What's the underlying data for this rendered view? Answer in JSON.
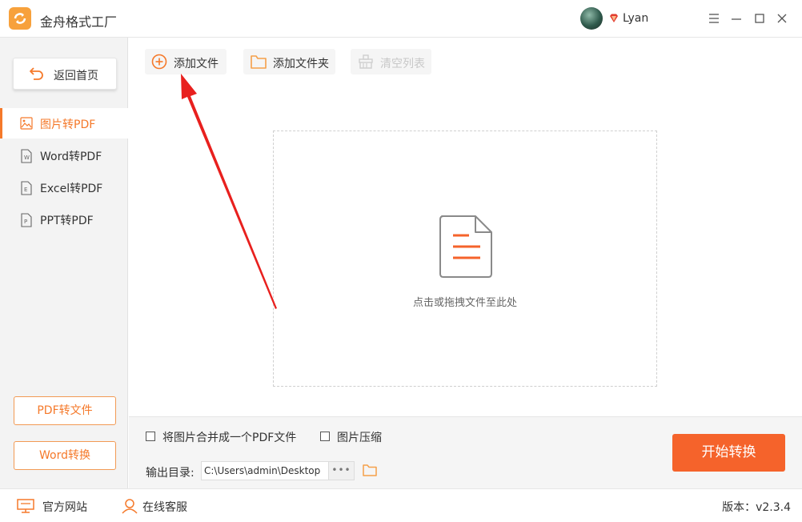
{
  "app": {
    "title": "金舟格式工厂"
  },
  "user": {
    "name": "Lyan"
  },
  "sidebar": {
    "back_label": "返回首页",
    "items": [
      {
        "label": "图片转PDF",
        "active": true
      },
      {
        "label": "Word转PDF",
        "active": false
      },
      {
        "label": "Excel转PDF",
        "active": false
      },
      {
        "label": "PPT转PDF",
        "active": false
      }
    ],
    "bottom_buttons": [
      "PDF转文件",
      "Word转换"
    ]
  },
  "toolbar": {
    "add_file": "添加文件",
    "add_folder": "添加文件夹",
    "clear_list": "清空列表"
  },
  "dropzone": {
    "hint": "点击或拖拽文件至此处"
  },
  "options": {
    "merge_label": "将图片合并成一个PDF文件",
    "compress_label": "图片压缩",
    "output_label": "输出目录:",
    "output_path": "C:\\Users\\admin\\Desktop",
    "more_label": "•••",
    "start_label": "开始转换"
  },
  "statusbar": {
    "website": "官方网站",
    "support": "在线客服",
    "version": "版本：v2.3.4"
  },
  "colors": {
    "accent": "#f5792a",
    "start_button": "#f5632b",
    "arrow": "#e8201e"
  }
}
